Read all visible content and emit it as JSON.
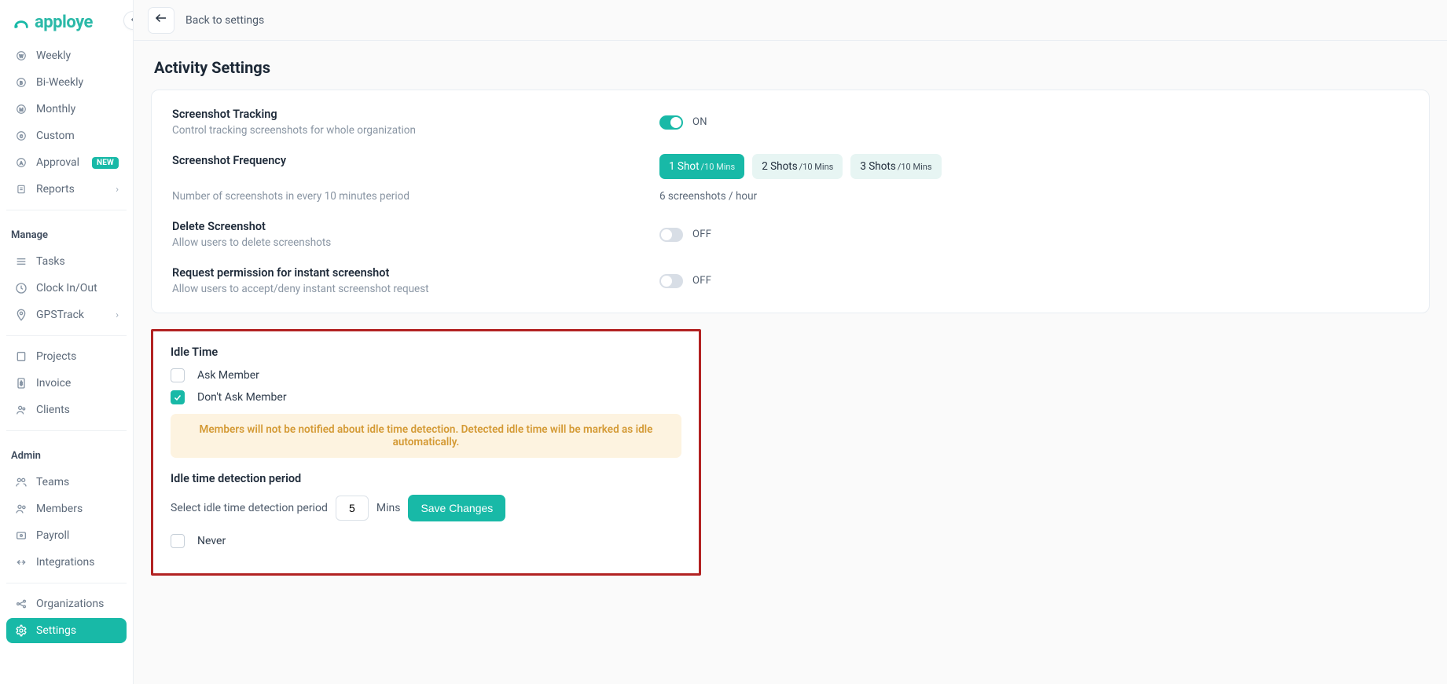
{
  "brand": {
    "name": "apploye"
  },
  "topbar": {
    "back_label": "Back to settings"
  },
  "sidebar": {
    "items_top": [
      {
        "label": "Weekly"
      },
      {
        "label": "Bi-Weekly"
      },
      {
        "label": "Monthly"
      },
      {
        "label": "Custom"
      },
      {
        "label": "Approval",
        "badge": "NEW"
      },
      {
        "label": "Reports",
        "chevron": true
      }
    ],
    "groups": [
      {
        "label": "Manage",
        "items": [
          {
            "label": "Tasks"
          },
          {
            "label": "Clock In/Out"
          },
          {
            "label": "GPSTrack",
            "chevron": true
          }
        ]
      },
      {
        "label": "",
        "items": [
          {
            "label": "Projects"
          },
          {
            "label": "Invoice"
          },
          {
            "label": "Clients"
          }
        ]
      },
      {
        "label": "Admin",
        "items": [
          {
            "label": "Teams"
          },
          {
            "label": "Members"
          },
          {
            "label": "Payroll"
          },
          {
            "label": "Integrations"
          }
        ]
      },
      {
        "label": "",
        "items": [
          {
            "label": "Organizations"
          },
          {
            "label": "Settings",
            "active": true
          }
        ]
      }
    ]
  },
  "page": {
    "title": "Activity Settings"
  },
  "settings": {
    "screenshot_tracking": {
      "title": "Screenshot Tracking",
      "desc": "Control tracking screenshots for whole organization",
      "state_label": "ON"
    },
    "screenshot_frequency": {
      "title": "Screenshot Frequency",
      "desc": "Number of screenshots in every 10 minutes period",
      "options": [
        {
          "main": "1 Shot",
          "sub": "/10 Mins",
          "active": true
        },
        {
          "main": "2 Shots",
          "sub": "/10 Mins"
        },
        {
          "main": "3 Shots",
          "sub": "/10 Mins"
        }
      ],
      "summary": "6 screenshots / hour"
    },
    "delete_screenshot": {
      "title": "Delete Screenshot",
      "desc": "Allow users to delete screenshots",
      "state_label": "OFF"
    },
    "request_permission": {
      "title": "Request permission for instant screenshot",
      "desc": "Allow users to accept/deny instant screenshot request",
      "state_label": "OFF"
    }
  },
  "idle": {
    "heading": "Idle Time",
    "ask_label": "Ask Member",
    "dont_ask_label": "Don't Ask Member",
    "notice": "Members will not be notified about idle time detection. Detected idle time will be marked as idle automatically.",
    "period_heading": "Idle time detection period",
    "period_desc": "Select idle time detection period",
    "period_value": "5",
    "period_unit": "Mins",
    "save_label": "Save Changes",
    "never_label": "Never"
  }
}
